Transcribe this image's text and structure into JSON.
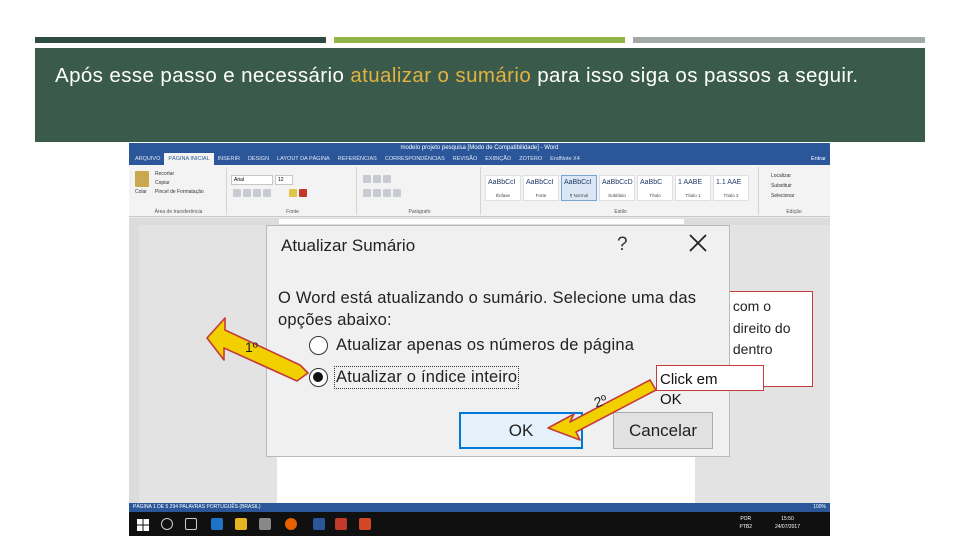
{
  "slide": {
    "title_before": "Após esse passo e necessário ",
    "title_highlight": "atualizar o sumário",
    "title_after": " para isso siga os passos a seguir.",
    "colors": {
      "band": "#3a5a4b",
      "highlight": "#e3b341",
      "bar1": "#2e4d3e",
      "bar2": "#93b548",
      "bar3": "#a3a8ab"
    }
  },
  "word": {
    "window_title": "modelo projeto pesquisa [Modo de Compatibilidade] - Word",
    "tabs": [
      "ARQUIVO",
      "PÁGINA INICIAL",
      "INSERIR",
      "DESIGN",
      "LAYOUT DA PÁGINA",
      "REFERÊNCIAS",
      "CORRESPONDÊNCIAS",
      "REVISÃO",
      "EXIBIÇÃO",
      "ZOTERO",
      "EndNote X4"
    ],
    "tab_right": "Entrar",
    "clipboard": {
      "cut": "Recortar",
      "copy": "Copiar",
      "painter": "Pincel de Formatação",
      "paste": "Colar",
      "group": "Área de transferência"
    },
    "font": {
      "name": "Arial",
      "size": "12",
      "group": "Fonte"
    },
    "paragraph_group": "Parágrafo",
    "styles_group": "Estilo",
    "styles": [
      {
        "sample": "AaBbCcI",
        "name": "Ênfase"
      },
      {
        "sample": "AaBbCcI",
        "name": "Forte"
      },
      {
        "sample": "AaBbCcI",
        "name": "¶ Normal"
      },
      {
        "sample": "AaBbCcD",
        "name": "Subtítulo"
      },
      {
        "sample": "AaBbC",
        "name": "Título"
      },
      {
        "sample": "1 AABE",
        "name": "Título 1"
      },
      {
        "sample": "1.1 AAE",
        "name": "Título 2"
      }
    ],
    "editing": {
      "find": "Localizar",
      "replace": "Substituir",
      "select": "Selecionar",
      "group": "Edição"
    },
    "status_left": "PÁGINA 1 DE 5    294 PALAVRAS    PORTUGUÊS (BRASIL)",
    "status_right": "100%",
    "taskbar": {
      "lang": "POR\nPTB2",
      "clock": "15:50\n24/07/2017"
    }
  },
  "dialog": {
    "title": "Atualizar Sumário",
    "help": "?",
    "message": "O Word está atualizando o sumário. Selecione uma das opções abaixo:",
    "option_pages": "Atualizar apenas os números de página",
    "option_full": "Atualizar o índice inteiro",
    "ok": "OK",
    "cancel": "Cancelar"
  },
  "callouts": {
    "behind_text": " com o\n direito do\n dentro\n ",
    "front_text": "Click em\nOK",
    "border_color": "#c43b3b"
  },
  "steps": {
    "first": "1º",
    "second": "2º",
    "arrow_color": "#f2d000"
  }
}
